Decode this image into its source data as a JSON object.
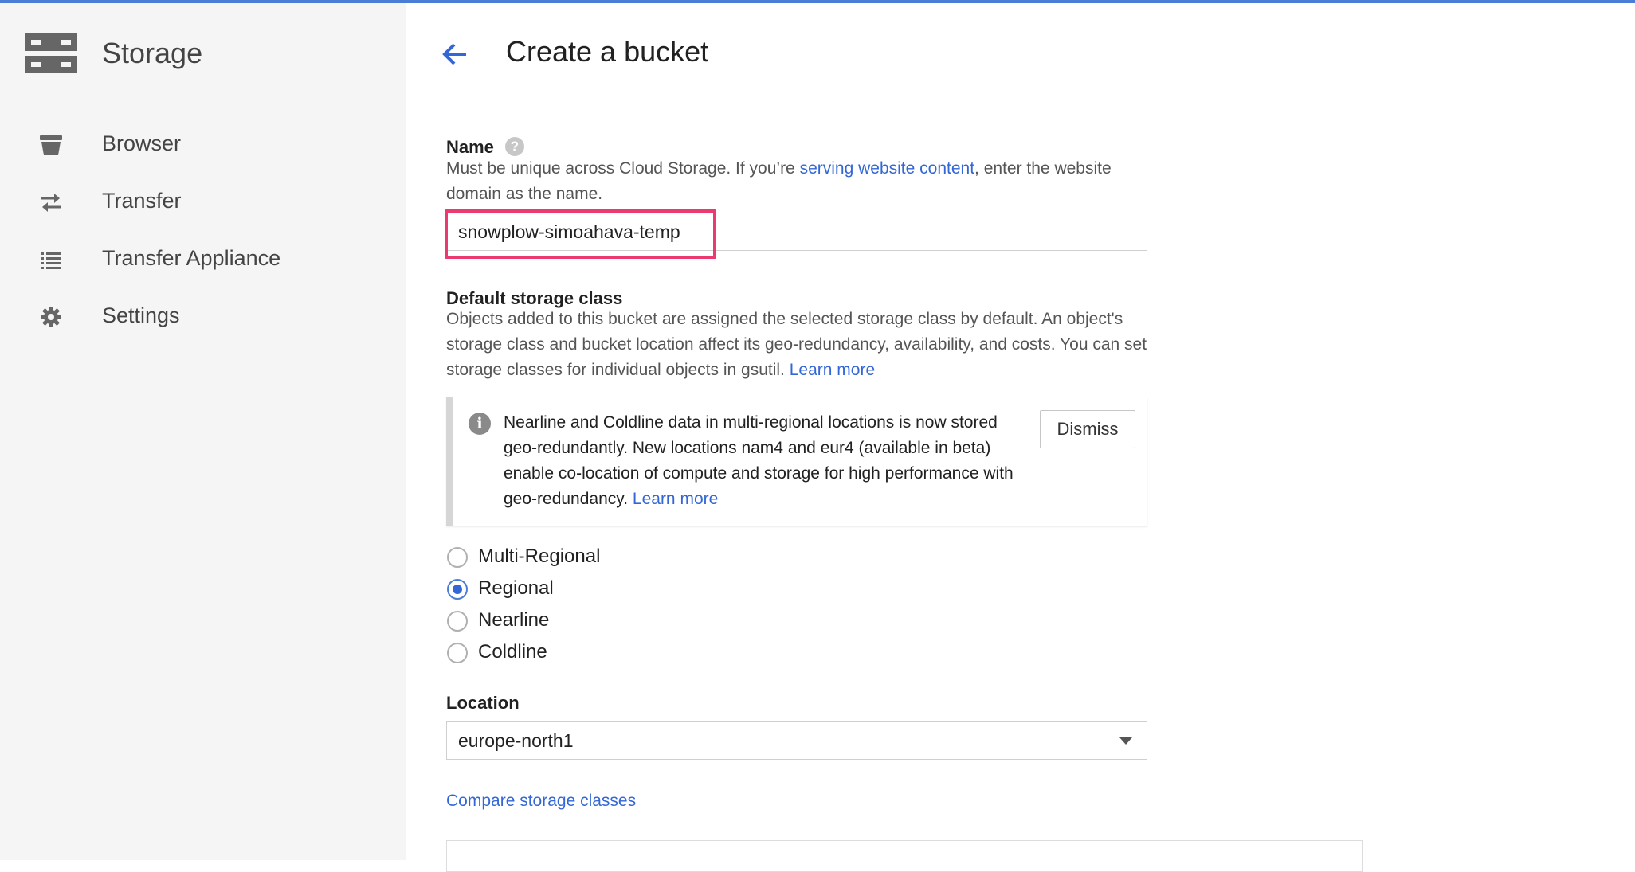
{
  "colors": {
    "accent": "#3367d6",
    "highlight": "#ea3a6f",
    "topbar": "#4a7ed6"
  },
  "sidebar": {
    "title": "Storage",
    "logo_icon": "storage-icon",
    "items": [
      {
        "label": "Browser",
        "icon": "bucket-icon"
      },
      {
        "label": "Transfer",
        "icon": "transfer-arrows-icon"
      },
      {
        "label": "Transfer Appliance",
        "icon": "list-icon"
      },
      {
        "label": "Settings",
        "icon": "gear-icon"
      }
    ]
  },
  "header": {
    "title": "Create a bucket",
    "back_icon": "arrow-back-icon"
  },
  "name_section": {
    "label": "Name",
    "help_icon": "help-icon",
    "help_glyph": "?",
    "desc_before": "Must be unique across Cloud Storage. If you’re ",
    "desc_link": "serving website content",
    "desc_after": ", enter the website domain as the name.",
    "value": "snowplow-simoahava-temp"
  },
  "storage_class": {
    "label": "Default storage class",
    "desc": "Objects added to this bucket are assigned the selected storage class by default. An object's storage class and bucket location affect its geo-redundancy, availability, and costs. You can set storage classes for individual objects in gsutil.",
    "learn_more": "Learn more",
    "notice": {
      "icon": "info-icon",
      "icon_glyph": "i",
      "text": "Nearline and Coldline data in multi-regional locations is now stored geo-redundantly. New locations nam4 and eur4 (available in beta) enable co-location of compute and storage for high performance with geo-redundancy.",
      "learn_more": "Learn more",
      "dismiss": "Dismiss"
    },
    "options": [
      {
        "label": "Multi-Regional",
        "checked": false
      },
      {
        "label": "Regional",
        "checked": true
      },
      {
        "label": "Nearline",
        "checked": false
      },
      {
        "label": "Coldline",
        "checked": false
      }
    ]
  },
  "location": {
    "label": "Location",
    "value": "europe-north1"
  },
  "compare_link": "Compare storage classes"
}
